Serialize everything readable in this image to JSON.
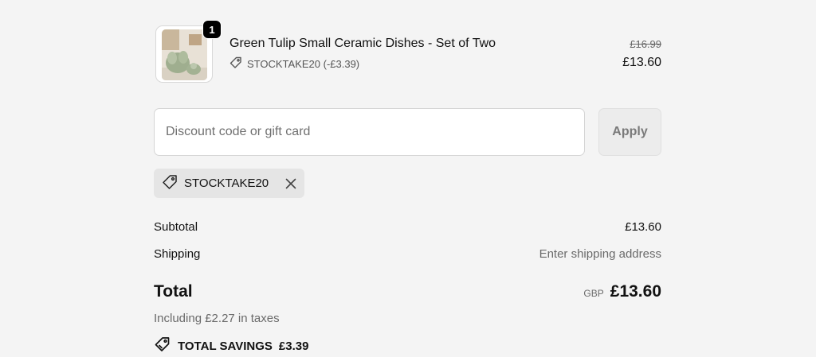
{
  "product": {
    "quantity": "1",
    "name": "Green Tulip Small Ceramic Dishes - Set of Two",
    "discount_label": "STOCKTAKE20 (-£3.39)",
    "original_price": "£16.99",
    "price": "£13.60"
  },
  "discount": {
    "placeholder": "Discount code or gift card",
    "apply_label": "Apply",
    "applied_code": "STOCKTAKE20"
  },
  "summary": {
    "subtotal_label": "Subtotal",
    "subtotal_value": "£13.60",
    "shipping_label": "Shipping",
    "shipping_value": "Enter shipping address",
    "total_label": "Total",
    "currency": "GBP",
    "total_value": "£13.60",
    "taxes_note": "Including £2.27 in taxes",
    "savings_label": "TOTAL SAVINGS",
    "savings_value": "£3.39"
  },
  "icons": [
    "tag-icon",
    "close-icon",
    "savings-tag-icon"
  ],
  "colors": {
    "background": "#f4f4f4",
    "badge": "#000000",
    "chip": "#e5e5e5",
    "apply_button": "#ececec"
  }
}
